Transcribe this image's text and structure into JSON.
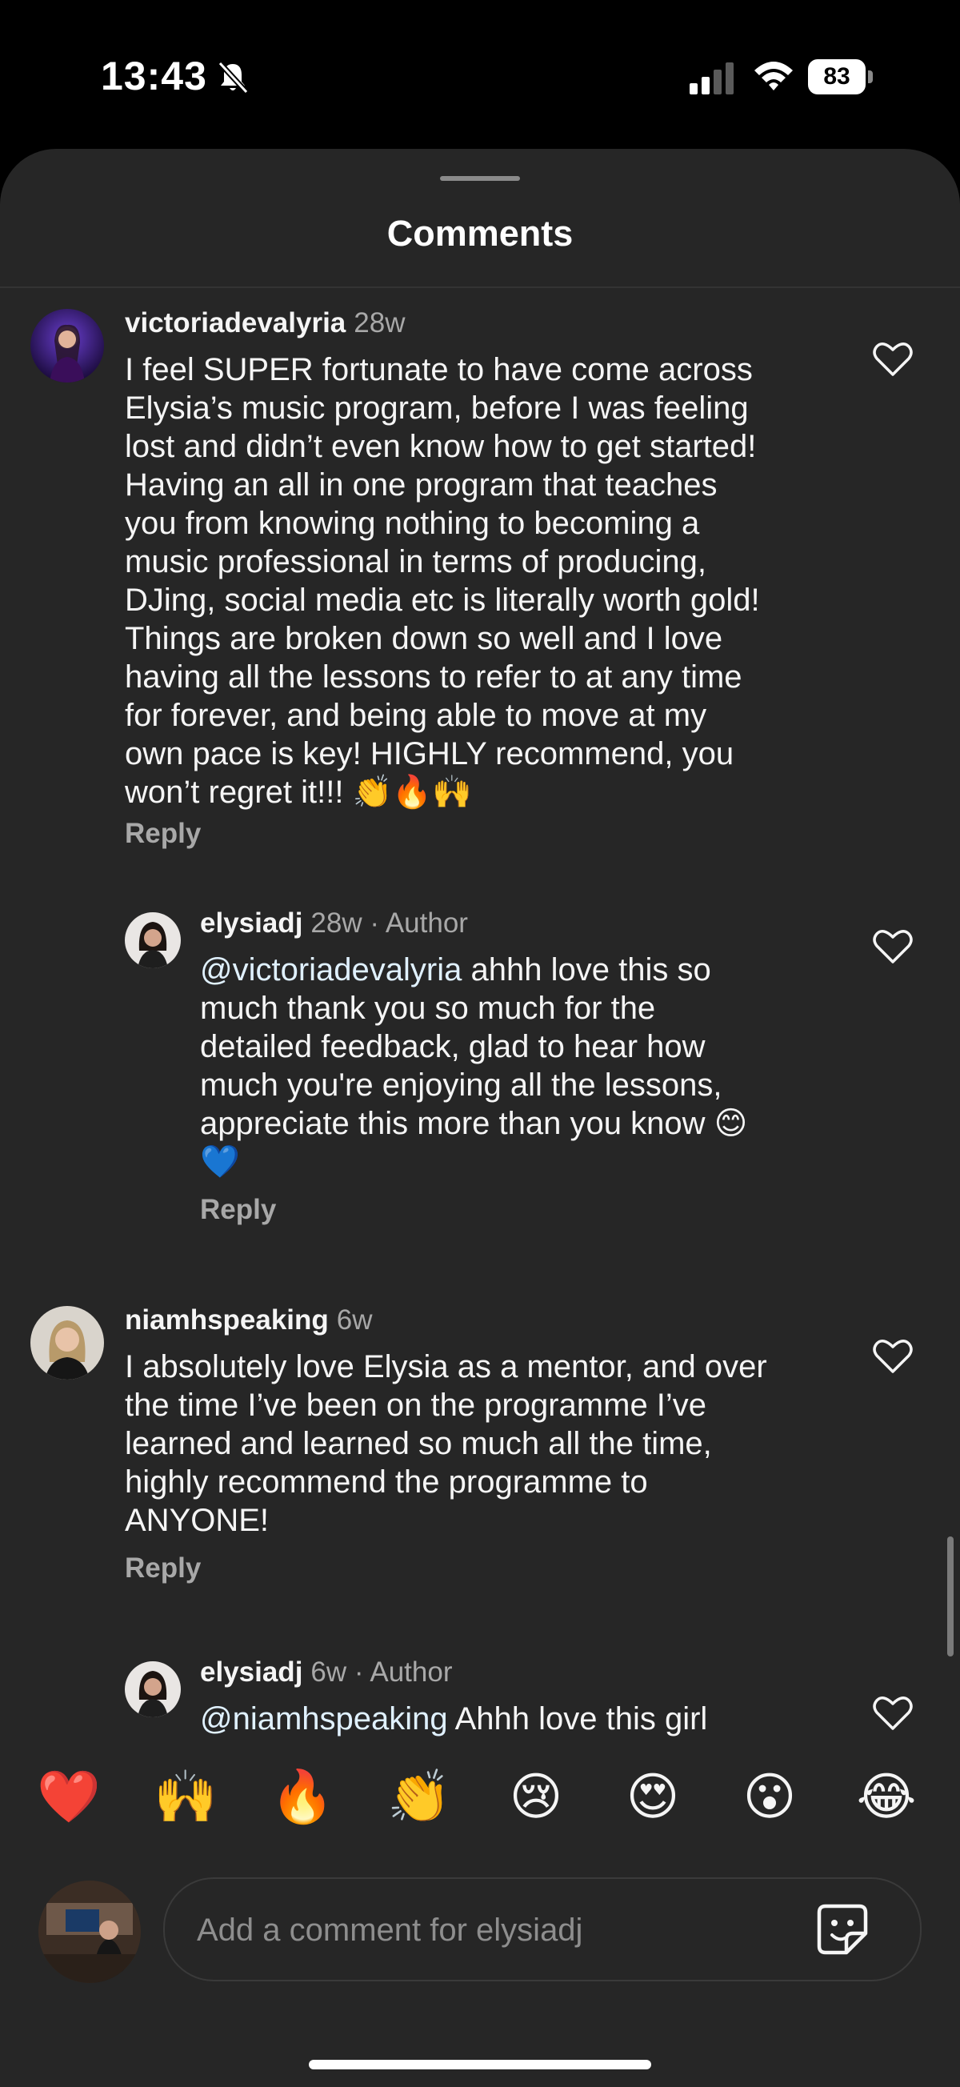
{
  "status_bar": {
    "time": "13:43",
    "battery": "83"
  },
  "sheet": {
    "title": "Comments"
  },
  "comments": [
    {
      "username": "victoriadevalyria",
      "time": "28w",
      "lines": [
        "I feel SUPER fortunate to have come across",
        "Elysia’s music program, before I was feeling",
        "lost and didn’t even know how to get started!",
        "Having an all in one program that teaches",
        "you from knowing nothing to becoming a",
        "music professional in terms of producing,",
        "DJing, social media etc is literally worth gold!",
        "Things are broken down so well and I love",
        "having all the lessons to refer to at any time",
        "for forever, and being able to move at my",
        "own pace is key! HIGHLY recommend, you",
        "won’t regret it!!! 👏🔥🙌"
      ],
      "reply": "Reply"
    },
    {
      "username": "elysiadj",
      "time": "28w",
      "author": "· Author",
      "mention": "@victoriadevalyria",
      "lines": [
        " ahhh love this so",
        "much thank you so much for the",
        "detailed feedback, glad to hear how",
        "much you're enjoying all the lessons,",
        "appreciate this more than you know 😊",
        "💙"
      ],
      "reply": "Reply"
    },
    {
      "username": "niamhspeaking",
      "time": "6w",
      "lines": [
        "I absolutely love Elysia as a mentor, and over",
        "the time I’ve been on the programme I’ve",
        "learned and learned so much all the time,",
        "highly recommend the programme to",
        "ANYONE!"
      ],
      "reply": "Reply"
    },
    {
      "username": "elysiadj",
      "time": "6w",
      "author": "· Author",
      "mention": "@niamhspeaking",
      "lines": [
        " Ahhh love this girl"
      ]
    }
  ],
  "emoji_bar": [
    "❤️",
    "🙌",
    "🔥",
    "👏",
    "😢",
    "😍",
    "😮",
    "😂"
  ],
  "composer": {
    "placeholder": "Add a comment for elysiadj"
  },
  "colors": {
    "sheet_bg": "#262626",
    "text": "#f5f5f5",
    "muted": "#a8a8a8",
    "mention": "#e0f1ff"
  }
}
